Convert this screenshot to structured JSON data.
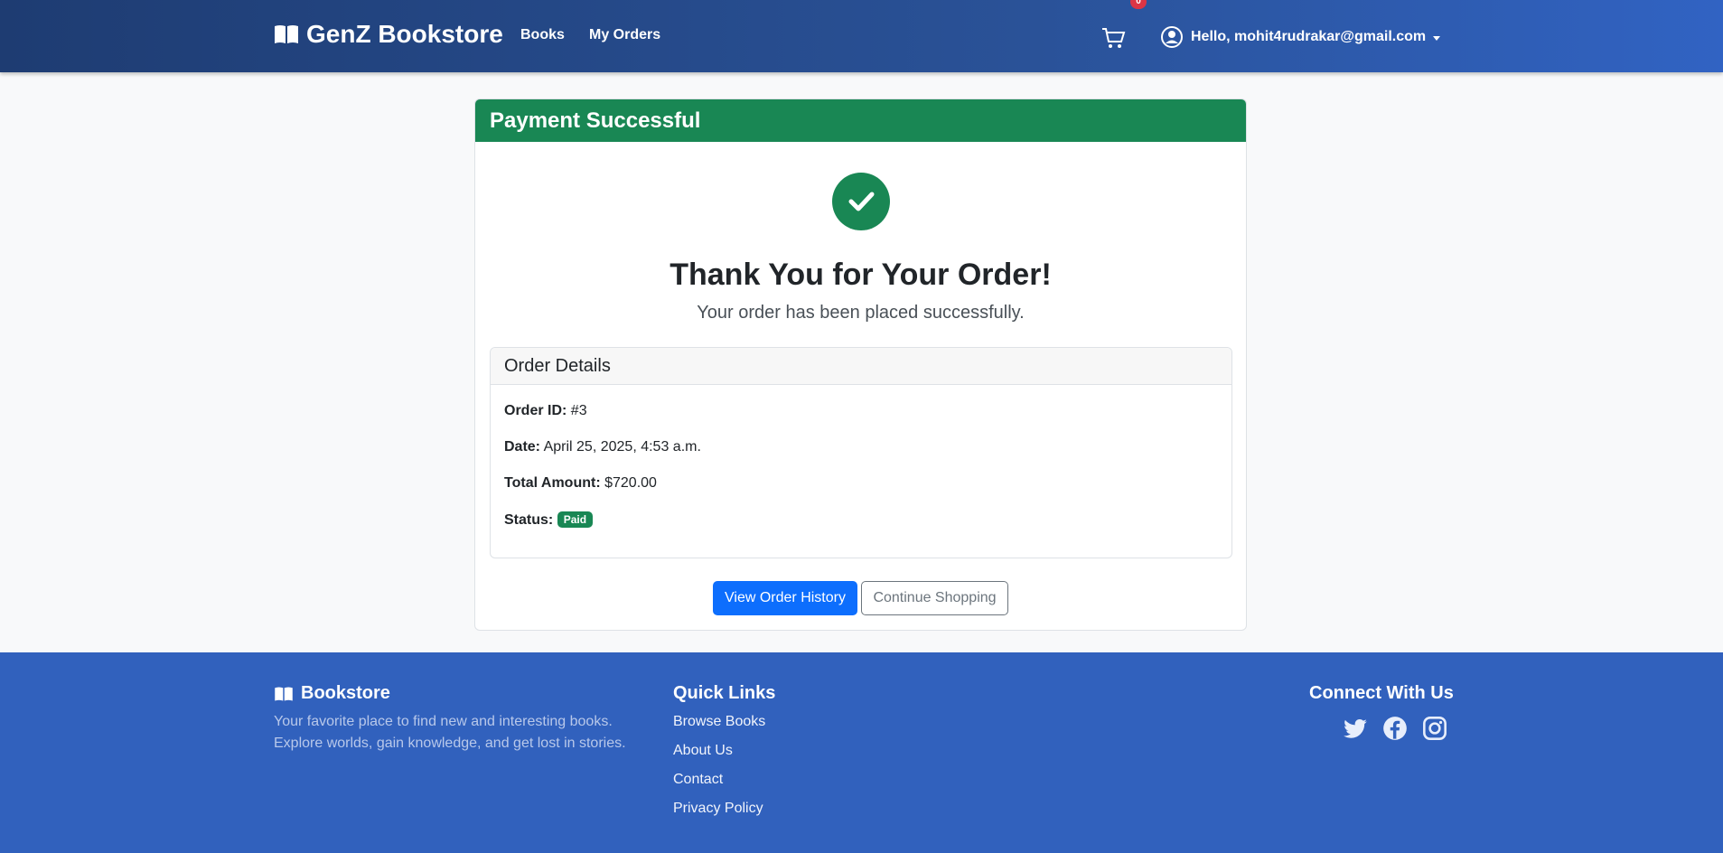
{
  "nav": {
    "brand": "GenZ Bookstore",
    "links": [
      "Books",
      "My Orders"
    ],
    "cart_count": "0",
    "user_greeting": "Hello, mohit4rudrakar@gmail.com"
  },
  "card": {
    "header": "Payment Successful",
    "heading": "Thank You for Your Order!",
    "subtext": "Your order has been placed successfully.",
    "details": {
      "title": "Order Details",
      "order_id_label": "Order ID:",
      "order_id": "#3",
      "date_label": "Date:",
      "date": "April 25, 2025, 4:53 a.m.",
      "total_label": "Total Amount:",
      "total": "$720.00",
      "status_label": "Status:",
      "status": "Paid"
    },
    "buttons": {
      "history": "View Order History",
      "continue": "Continue Shopping"
    }
  },
  "footer": {
    "brand": "Bookstore",
    "description_line1": "Your favorite place to find new and interesting books.",
    "description_line2": "Explore worlds, gain knowledge, and get lost in stories.",
    "quick_links_title": "Quick Links",
    "links": [
      "Browse Books",
      "About Us",
      "Contact",
      "Privacy Policy"
    ],
    "connect_title": "Connect With Us",
    "social_icons": [
      "twitter-icon",
      "facebook-icon",
      "instagram-icon"
    ]
  },
  "colors": {
    "success": "#198754",
    "primary": "#0d6efd",
    "navbar": "#2a5298",
    "footer": "#3161bd",
    "badge": "#dc3545"
  }
}
